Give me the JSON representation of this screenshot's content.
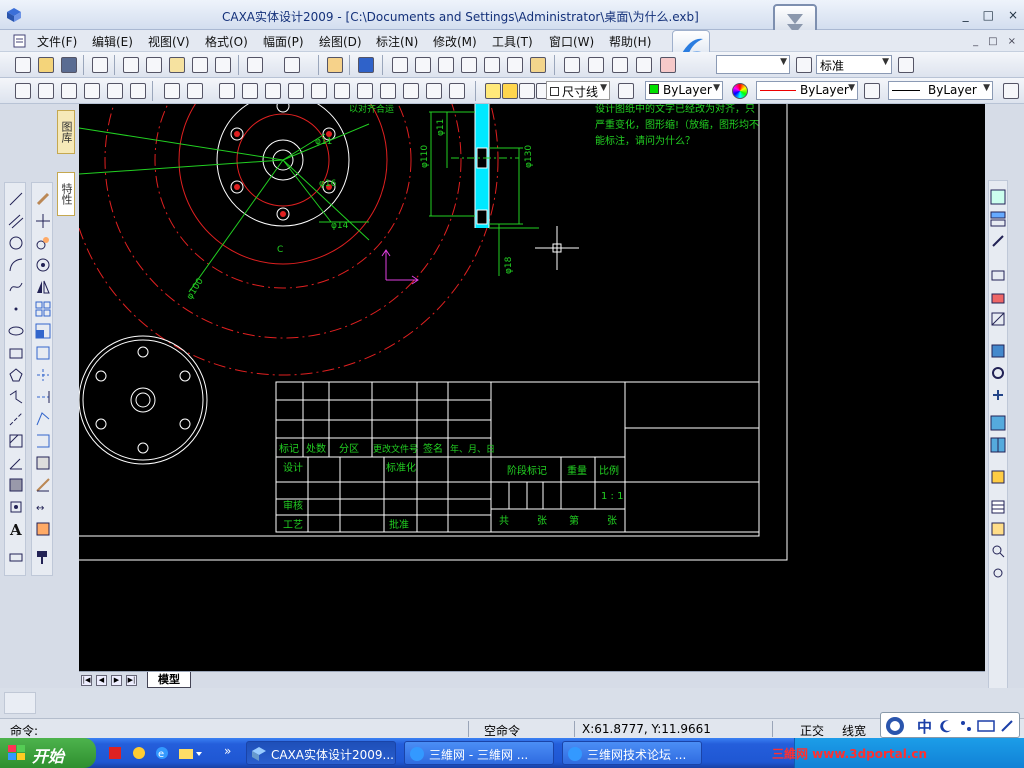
{
  "window": {
    "title": "CAXA实体设计2009 - [C:\\Documents and Settings\\Administrator\\桌面\\为什么.exb]",
    "controls": [
      "_",
      "□",
      "×"
    ]
  },
  "menu": {
    "items": [
      "文件(F)",
      "编辑(E)",
      "视图(V)",
      "格式(O)",
      "幅面(P)",
      "绘图(D)",
      "标注(N)",
      "修改(M)",
      "工具(T)",
      "窗口(W)",
      "帮助(H)"
    ],
    "mdi_controls": [
      "_",
      "□",
      "×"
    ]
  },
  "toolbar_standard": {
    "text_style": "标准"
  },
  "toolbar_properties": {
    "layer": "尺寸线",
    "color": "ByLayer",
    "linetype": "ByLayer",
    "lineweight": "ByLayer",
    "layer_color": "#00e000"
  },
  "left_panel": {
    "tab_drawing": "图库",
    "tab_properties": "特性"
  },
  "drawing": {
    "notes": [
      "设计图纸中的文字已经改为对齐，只",
      "严重变化，图形缩!（放缩，图形均不",
      "能标注，请问为什么？"
    ],
    "partial_note": "以对齐合运",
    "dims": [
      "φ11",
      "φ16",
      "φ110",
      "φ130",
      "φ14",
      "φ100",
      "φ18",
      "C"
    ],
    "title_block": {
      "headers": [
        "标记",
        "处数",
        "分区",
        "更改文件号",
        "签名",
        "年、月、日"
      ],
      "left_rows": [
        "设计",
        "审核",
        "工艺"
      ],
      "mid_labels": [
        "标准化",
        "批准"
      ],
      "stage": "阶段标记",
      "weight": "重量",
      "scale": "比例",
      "scale_value": "1 : 1",
      "sheet_total": "共",
      "sheet_zhang": "张",
      "sheet_num": "第",
      "sheet_zhang2": "张"
    }
  },
  "sheet_tabs": {
    "nav": [
      "|◀",
      "◀",
      "▶",
      "▶|"
    ],
    "active_tab": "模型"
  },
  "command": {
    "prompt": "命令:"
  },
  "status": {
    "command_state": "空命令",
    "coords": "X:61.8777, Y:11.9661",
    "ortho": "正交",
    "linewidth": "线宽"
  },
  "ime": {
    "mode": "中"
  },
  "taskbar": {
    "start": "开始",
    "tasks": [
      "CAXA实体设计2009...",
      "三維网 - 三維网 ...",
      "三维网技术论坛 ..."
    ],
    "watermark": "三維网 www.3dportal.cn"
  }
}
